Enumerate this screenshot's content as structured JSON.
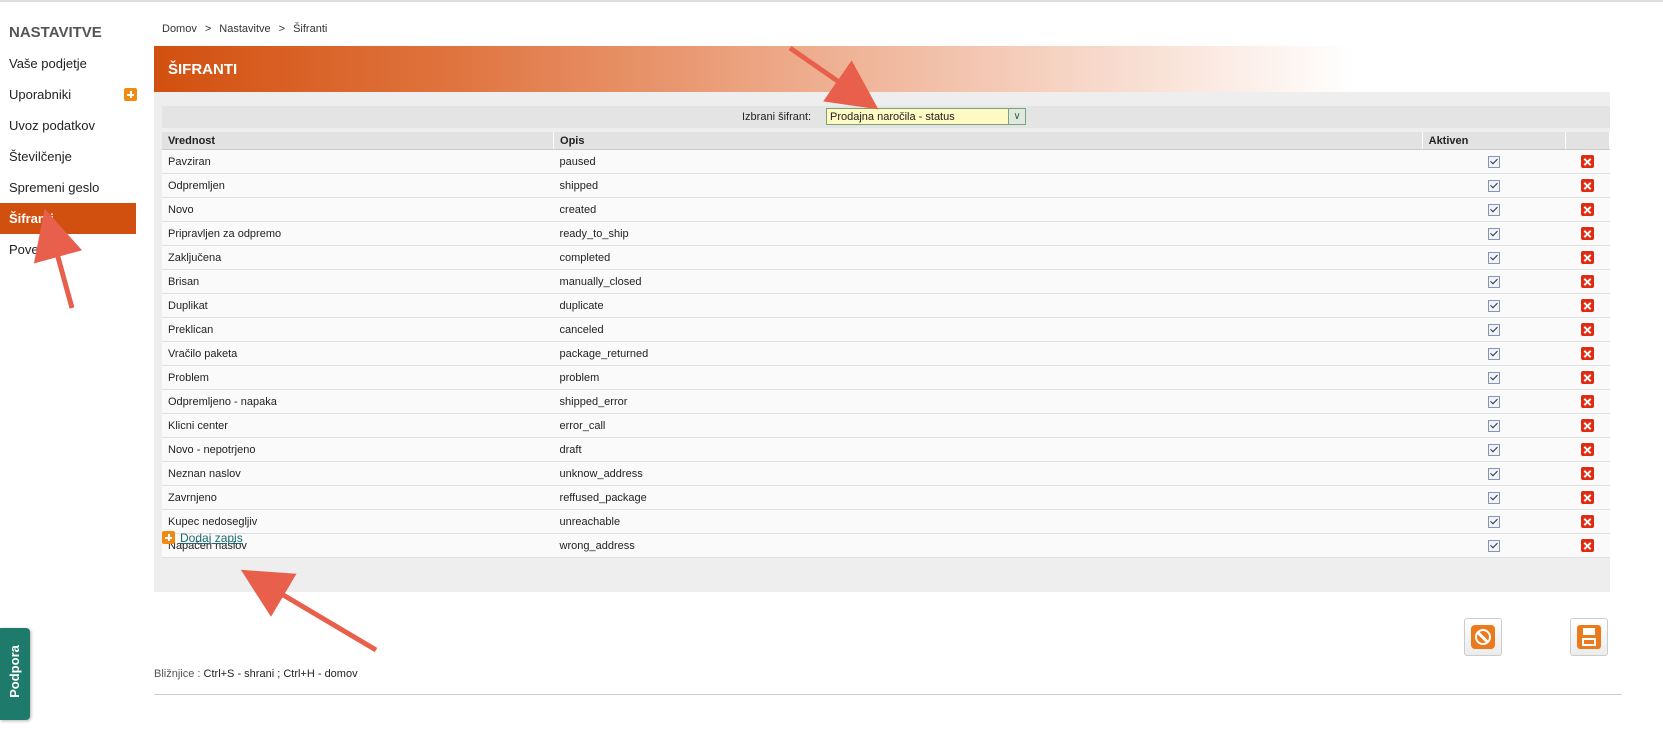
{
  "sidebar": {
    "title": "NASTAVITVE",
    "items": [
      {
        "label": "Vaše podjetje"
      },
      {
        "label": "Uporabniki"
      },
      {
        "label": "Uvoz podatkov"
      },
      {
        "label": "Številčenje"
      },
      {
        "label": "Spremeni geslo"
      },
      {
        "label": "Šifranti"
      },
      {
        "label": "Povezave"
      }
    ]
  },
  "breadcrumb": {
    "items": [
      "Domov",
      "Nastavitve",
      "Šifranti"
    ],
    "separator": ">"
  },
  "header": {
    "title": "ŠIFRANTI"
  },
  "selector": {
    "label": "Izbrani šifrant:",
    "value": "Prodajna naročila - status"
  },
  "table": {
    "columns": [
      "Vrednost",
      "Opis",
      "Aktiven",
      ""
    ],
    "rows": [
      {
        "value": "Pavziran",
        "desc": "paused",
        "active": true
      },
      {
        "value": "Odpremljen",
        "desc": "shipped",
        "active": true
      },
      {
        "value": "Novo",
        "desc": "created",
        "active": true
      },
      {
        "value": "Pripravljen za odpremo",
        "desc": "ready_to_ship",
        "active": true
      },
      {
        "value": "Zaključena",
        "desc": "completed",
        "active": true
      },
      {
        "value": "Brisan",
        "desc": "manually_closed",
        "active": true
      },
      {
        "value": "Duplikat",
        "desc": "duplicate",
        "active": true
      },
      {
        "value": "Preklican",
        "desc": "canceled",
        "active": true
      },
      {
        "value": "Vračilo paketa",
        "desc": "package_returned",
        "active": true
      },
      {
        "value": "Problem",
        "desc": "problem",
        "active": true
      },
      {
        "value": "Odpremljeno - napaka",
        "desc": "shipped_error",
        "active": true
      },
      {
        "value": "Klicni center",
        "desc": "error_call",
        "active": true
      },
      {
        "value": "Novo - nepotrjeno",
        "desc": "draft",
        "active": true
      },
      {
        "value": "Neznan naslov",
        "desc": "unknow_address",
        "active": true
      },
      {
        "value": "Zavrnjeno",
        "desc": "reffused_package",
        "active": true
      },
      {
        "value": "Kupec nedosegljiv",
        "desc": "unreachable",
        "active": true
      },
      {
        "value": "Napačen naslov",
        "desc": "wrong_address",
        "active": true
      }
    ]
  },
  "add_record": {
    "label": "Dodaj zapis"
  },
  "shortcuts": {
    "label": "Bližnjice :",
    "save": "Ctrl+S - shrani ;",
    "home": "Ctrl+H - domov"
  },
  "support": {
    "label": "Podpora"
  },
  "colors": {
    "brand": "#d2500f",
    "support": "#1e7a6a",
    "delete": "#e02a12"
  },
  "icons": [
    "plus-icon",
    "delete-icon",
    "checkbox-icon",
    "cancel-icon",
    "save-icon",
    "chevron-down-icon"
  ]
}
